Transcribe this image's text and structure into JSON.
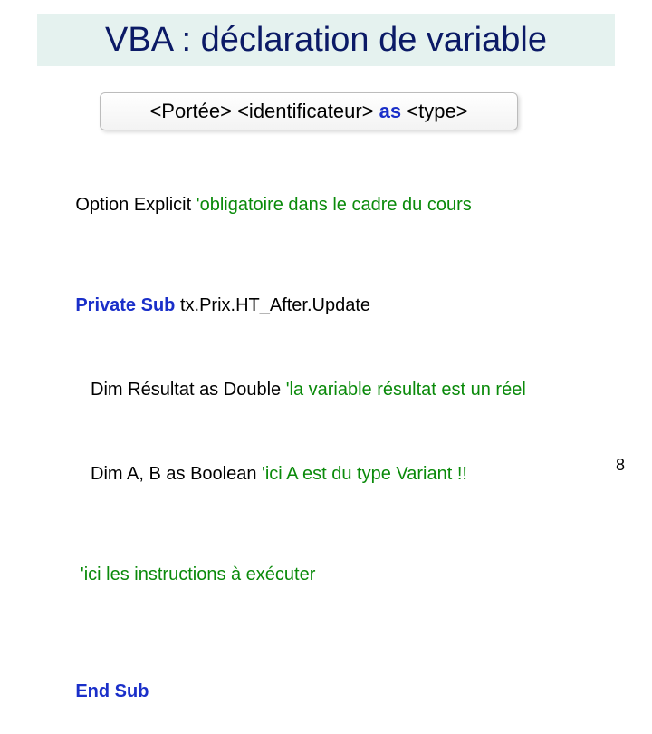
{
  "title": "VBA : déclaration de variable",
  "syntax": {
    "part1": "<Portée> <identificateur>",
    "keyword": "as",
    "part2": "<type>"
  },
  "code": {
    "option_explicit": "Option Explicit",
    "option_comment": "'obligatoire dans le cadre du cours",
    "private_sub": "Private Sub",
    "sub_name": "tx.Prix.HT_After.Update",
    "dim1_kw": "Dim",
    "dim1_var": "Résultat",
    "dim1_as": "as",
    "dim1_type": "Double",
    "dim1_comment": "'la variable résultat est un réel",
    "dim2_kw": "Dim",
    "dim2_vars": "A, B",
    "dim2_as": "as",
    "dim2_type": "Boolean",
    "dim2_comment": "'ici A est du type Variant !!",
    "body_comment": "'ici les instructions à exécuter",
    "end_sub": "End Sub"
  },
  "page_number": "8"
}
